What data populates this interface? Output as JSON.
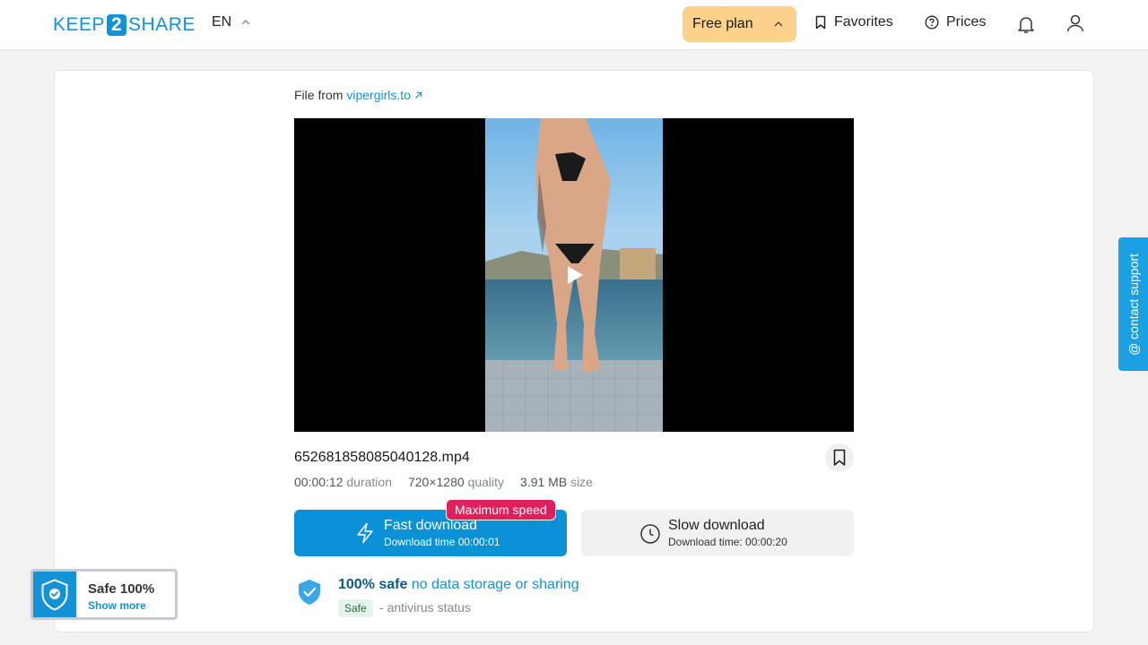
{
  "header": {
    "logo_left": "KEEP",
    "logo_mid": "2",
    "logo_right": "SHARE",
    "language": "EN",
    "plan_label": "Free plan",
    "favorites_label": "Favorites",
    "prices_label": "Prices"
  },
  "file": {
    "from_prefix": "File from",
    "source_link": "vipergirls.to",
    "name": "652681858085040128.mp4",
    "duration_value": "00:00:12",
    "duration_label": "duration",
    "quality_value": "720×1280",
    "quality_label": "quality",
    "size_value": "3.91 MB",
    "size_label": "size"
  },
  "download": {
    "badge": "Maximum speed",
    "fast_label": "Fast download",
    "fast_time": "Download time 00:00:01",
    "slow_label": "Slow download",
    "slow_time": "Download time: 00:00:20"
  },
  "safety": {
    "bold": "100% safe",
    "rest": "no data storage or sharing",
    "badge": "Safe",
    "status": "- antivirus status"
  },
  "support": {
    "label": "@ contact support"
  },
  "widget": {
    "title": "Safe 100%",
    "link": "Show more"
  },
  "colors": {
    "brand": "#1492d6",
    "plan": "#fcd28a",
    "badge": "#e0205c",
    "support": "#1ba1e2"
  }
}
